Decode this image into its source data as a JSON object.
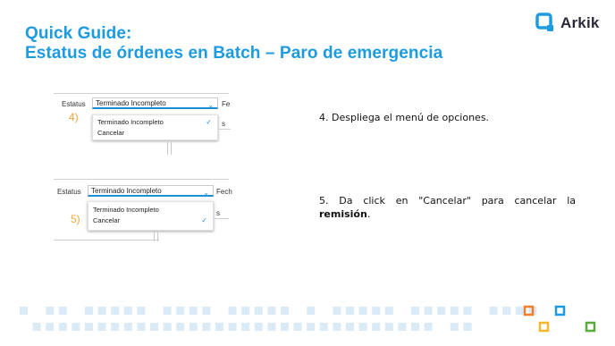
{
  "header": {
    "title_line1": "Quick Guide:",
    "title_line2": "Estatus de órdenes en Batch – Paro de emergencia"
  },
  "logo": {
    "text": "Arkik",
    "icon": "arkik-q-logo-icon",
    "color": "#1d9be0"
  },
  "screenshot1": {
    "field_label": "Estatus",
    "selected_value": "Terminado Incompleto",
    "next_label_fragment": "Fe",
    "row_fragment": "s",
    "step_number": "4)",
    "options": [
      "Terminado Incompleto",
      "Cancelar"
    ],
    "checked_option": "Terminado Incompleto"
  },
  "screenshot2": {
    "field_label": "Estatus",
    "selected_value": "Terminado Incompleto",
    "next_label_fragment": "Fech",
    "row_fragment": "s",
    "step_number": "5)",
    "options": [
      "Terminado Incompleto",
      "Cancelar"
    ],
    "checked_option": "Cancelar"
  },
  "instructions": {
    "step4": "4. Despliega el menú de opciones.",
    "step5_text": "5. Da click en \"Cancelar\" para cancelar la",
    "step5_bold": "remisión",
    "step5_end": "."
  },
  "colors": {
    "title": "#1d9be0",
    "step_number": "#f4a338",
    "accent": "#1d8fd8",
    "deco_light": "#dbeaf7",
    "square_orange": "#f07e2b",
    "square_blue": "#1d9be0",
    "square_yellow": "#f4b82c",
    "square_green": "#5aaa3c"
  }
}
